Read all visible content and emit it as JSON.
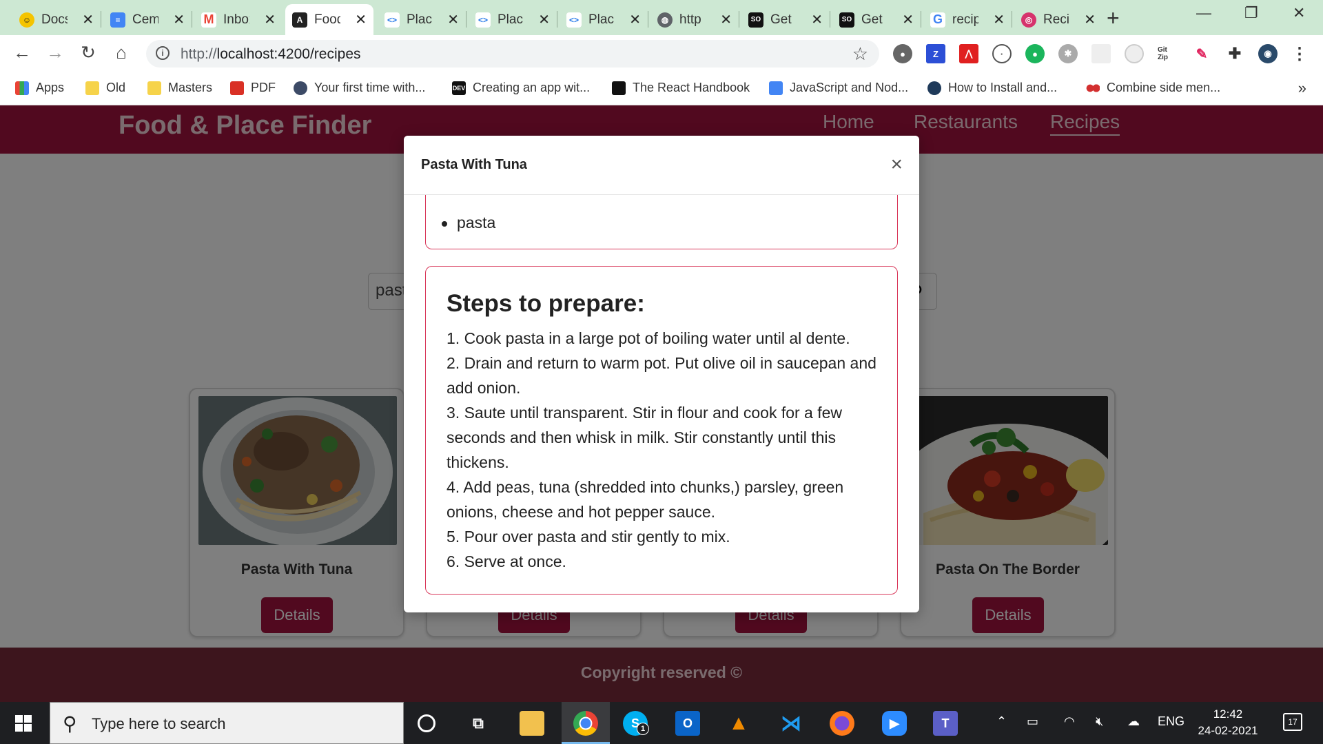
{
  "browser": {
    "tabs": [
      {
        "title": "Docs",
        "icon": "docs-logo-icon",
        "color": "#f5c400"
      },
      {
        "title": "Cem",
        "icon": "google-docs-icon",
        "color": "#4285f4"
      },
      {
        "title": "Inbox",
        "icon": "gmail-icon",
        "color": "#ea4335"
      },
      {
        "title": "Food",
        "icon": "angular-icon",
        "color": "#222222"
      },
      {
        "title": "Plac",
        "icon": "code-icon",
        "color": "#1a73e8"
      },
      {
        "title": "Plac",
        "icon": "code-icon",
        "color": "#1a73e8"
      },
      {
        "title": "Plac",
        "icon": "code-icon",
        "color": "#1a73e8"
      },
      {
        "title": "http",
        "icon": "globe-icon",
        "color": "#5f6368"
      },
      {
        "title": "Get",
        "icon": "stackoverflow-icon",
        "color": "#111111"
      },
      {
        "title": "Get",
        "icon": "stackoverflow-icon",
        "color": "#111111"
      },
      {
        "title": "recip",
        "icon": "google-icon",
        "color": "#4285f4"
      },
      {
        "title": "Reci",
        "icon": "dribbble-icon",
        "color": "#d6336c"
      }
    ],
    "active_tab_index": 3,
    "url_prefix": "http://",
    "url": "localhost:4200/recipes",
    "bookmarks": [
      {
        "label": "Apps",
        "icon": "apps-grid-icon"
      },
      {
        "label": "Old",
        "icon": "folder-icon"
      },
      {
        "label": "Masters",
        "icon": "folder-icon"
      },
      {
        "label": "PDF",
        "icon": "pdf-icon"
      },
      {
        "label": "Your first time with...",
        "icon": "bookmark-page-icon"
      },
      {
        "label": "Creating an app wit...",
        "icon": "dev-icon"
      },
      {
        "label": "The React Handbook",
        "icon": "react-handbook-icon"
      },
      {
        "label": "JavaScript and Nod...",
        "icon": "google-docs-icon"
      },
      {
        "label": "How to Install and...",
        "icon": "react-icon"
      },
      {
        "label": "Combine side men...",
        "icon": "dots-icon"
      }
    ],
    "bookmarks_more": "»"
  },
  "app": {
    "brand": "Food & Place Finder",
    "nav": [
      {
        "label": "Home",
        "active": false
      },
      {
        "label": "Restaurants",
        "active": false
      },
      {
        "label": "Recipes",
        "active": true
      }
    ],
    "search_value": "pasta",
    "cards": [
      {
        "title": "Pasta With Tuna",
        "button": "Details"
      },
      {
        "title": "",
        "button": "Details"
      },
      {
        "title": "",
        "button": "Details"
      },
      {
        "title": "Pasta On The Border",
        "button": "Details"
      }
    ],
    "footer": "Copyright reserved ©"
  },
  "modal": {
    "title": "Pasta With Tuna",
    "close": "×",
    "ingredients": [
      "pasta"
    ],
    "steps_heading": "Steps to prepare:",
    "steps": [
      "1. Cook pasta in a large pot of boiling water until al dente.",
      "2. Drain and return to warm pot. Put olive oil in saucepan and add onion.",
      "3. Saute until transparent. Stir in flour and cook for a few seconds and then whisk in milk. Stir constantly until this thickens.",
      "4. Add peas, tuna (shredded into chunks,) parsley, green onions, cheese and hot pepper sauce.",
      "5. Pour over pasta and stir gently to mix.",
      "6. Serve at once."
    ]
  },
  "taskbar": {
    "search_placeholder": "Type here to search",
    "skype_badge": "1",
    "language": "ENG",
    "time": "12:42",
    "date": "24-02-2021",
    "notification_count": "17"
  },
  "colors": {
    "brand_primary": "#a3133f",
    "modal_border": "#d9385a",
    "tabstrip": "#cde8d3"
  }
}
